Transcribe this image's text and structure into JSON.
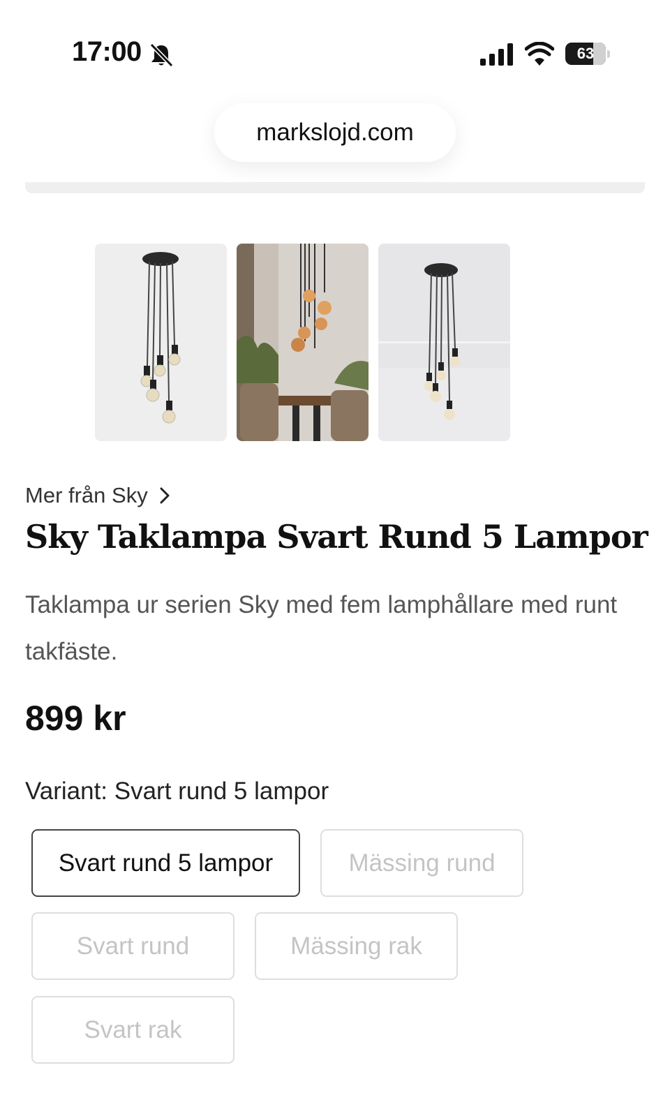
{
  "status_bar": {
    "time": "17:00",
    "battery": "63"
  },
  "browser": {
    "url": "markslojd.com"
  },
  "gallery": {
    "images": [
      "lamp-white-background",
      "lamp-dining-room",
      "lamp-light-wall"
    ]
  },
  "product": {
    "brand_link": "Mer från Sky",
    "title": "Sky Taklampa Svart Rund 5 Lampor",
    "description": "Taklampa ur serien Sky med fem lamphållare med runt takfäste.",
    "price": "899 kr",
    "variant_label": "Variant: Svart rund 5 lampor",
    "variants": [
      "Svart rund 5 lampor",
      "Mässing rund",
      "Svart rund",
      "Mässing rak",
      "Svart rak"
    ],
    "selected_variant": "Svart rund 5 lampor"
  }
}
